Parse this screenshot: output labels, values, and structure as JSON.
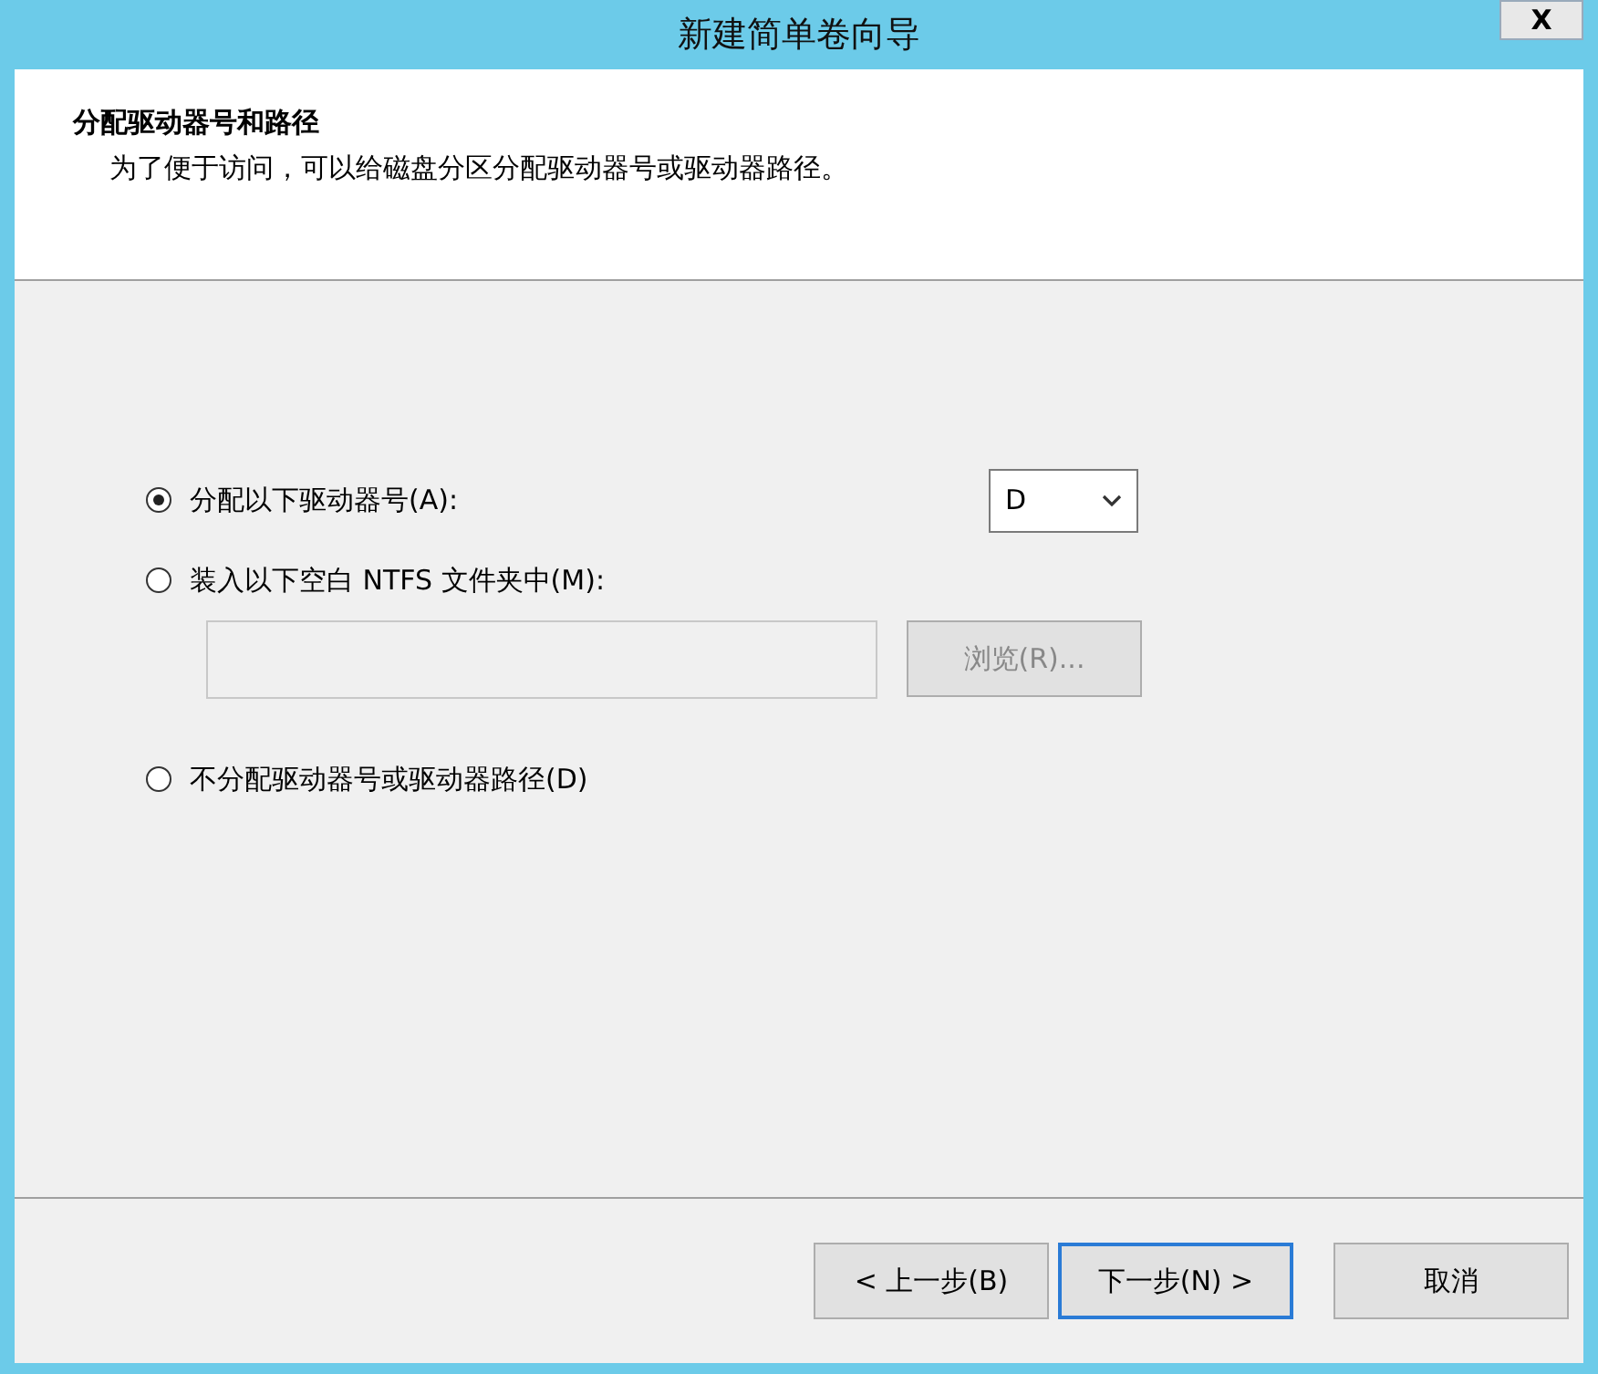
{
  "window": {
    "title": "新建简单卷向导",
    "close": "X"
  },
  "header": {
    "title": "分配驱动器号和路径",
    "subtitle": "为了便于访问，可以给磁盘分区分配驱动器号或驱动器路径。"
  },
  "options": [
    {
      "kind": "letter",
      "label": "分配以下驱动器号(A):",
      "selected": true,
      "value": "D"
    },
    {
      "kind": "folder",
      "label": "装入以下空白 NTFS 文件夹中(M):",
      "selected": false,
      "browse": "浏览(R)...",
      "disabled": true
    },
    {
      "kind": "plain",
      "label": "不分配驱动器号或驱动器路径(D)",
      "selected": false
    }
  ],
  "buttons": [
    {
      "label": "< 上一步(B)",
      "focused": false
    },
    {
      "label": "下一步(N) >",
      "focused": true
    },
    {
      "label": "取消",
      "focused": false
    }
  ]
}
